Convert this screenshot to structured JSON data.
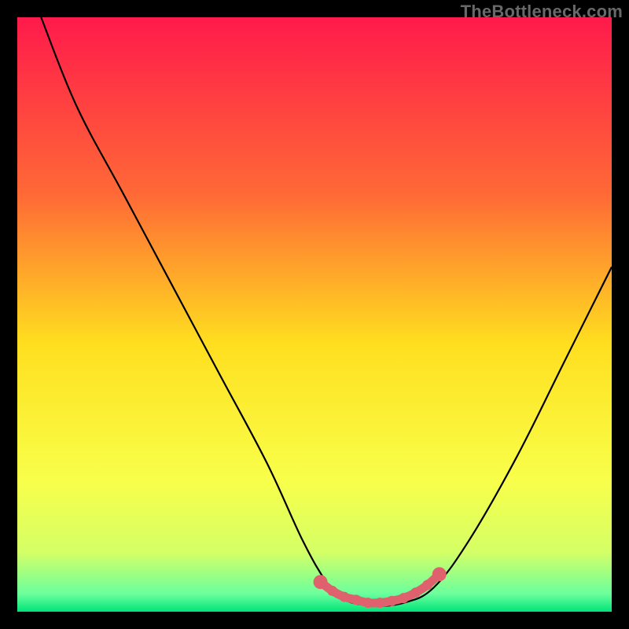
{
  "watermark": "TheBottleneck.com",
  "chart_data": {
    "type": "line",
    "title": "",
    "xlabel": "",
    "ylabel": "",
    "xlim": [
      0,
      100
    ],
    "ylim": [
      0,
      100
    ],
    "gradient_stops": [
      {
        "offset": 0,
        "color": "#ff1a4b"
      },
      {
        "offset": 0.3,
        "color": "#ff6a36"
      },
      {
        "offset": 0.55,
        "color": "#ffdf1f"
      },
      {
        "offset": 0.78,
        "color": "#f8ff4a"
      },
      {
        "offset": 0.9,
        "color": "#d4ff66"
      },
      {
        "offset": 0.97,
        "color": "#6bff9d"
      },
      {
        "offset": 1.0,
        "color": "#00e47a"
      }
    ],
    "series": [
      {
        "name": "bottleneck-curve",
        "type": "line",
        "color": "#000000",
        "points": [
          {
            "x": 4.0,
            "y": 100.0
          },
          {
            "x": 10.0,
            "y": 85.0
          },
          {
            "x": 18.0,
            "y": 70.0
          },
          {
            "x": 26.0,
            "y": 55.0
          },
          {
            "x": 34.0,
            "y": 40.0
          },
          {
            "x": 42.0,
            "y": 25.0
          },
          {
            "x": 48.0,
            "y": 12.0
          },
          {
            "x": 52.0,
            "y": 5.0
          },
          {
            "x": 55.0,
            "y": 2.0
          },
          {
            "x": 60.0,
            "y": 1.0
          },
          {
            "x": 65.0,
            "y": 1.5
          },
          {
            "x": 70.0,
            "y": 4.0
          },
          {
            "x": 76.0,
            "y": 12.0
          },
          {
            "x": 84.0,
            "y": 26.0
          },
          {
            "x": 92.0,
            "y": 42.0
          },
          {
            "x": 100.0,
            "y": 58.0
          }
        ]
      },
      {
        "name": "optimum-band",
        "type": "scatter",
        "color": "#e0616e",
        "points": [
          {
            "x": 51.0,
            "y": 5.0
          },
          {
            "x": 53.0,
            "y": 3.5
          },
          {
            "x": 55.0,
            "y": 2.5
          },
          {
            "x": 57.0,
            "y": 2.0
          },
          {
            "x": 59.0,
            "y": 1.5
          },
          {
            "x": 61.0,
            "y": 1.5
          },
          {
            "x": 63.0,
            "y": 1.8
          },
          {
            "x": 65.0,
            "y": 2.3
          },
          {
            "x": 67.0,
            "y": 3.2
          },
          {
            "x": 69.0,
            "y": 4.5
          },
          {
            "x": 71.0,
            "y": 6.3
          }
        ]
      }
    ]
  }
}
